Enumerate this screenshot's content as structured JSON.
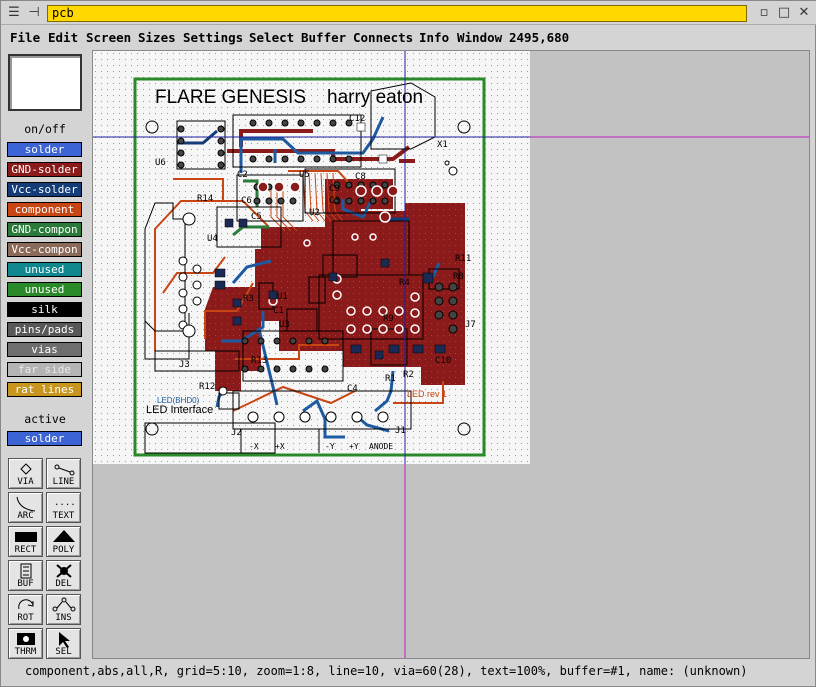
{
  "window": {
    "title": "pcb"
  },
  "menu": {
    "items": [
      "File",
      "Edit",
      "Screen",
      "Sizes",
      "Settings",
      "Select",
      "Buffer",
      "Connects",
      "Info",
      "Window"
    ],
    "cursor_coords": "2495,680"
  },
  "panel": {
    "onoff_label": "on/off",
    "active_label": "active",
    "active_layer": "solder",
    "active_layer_color": "#3c64d4",
    "layers": [
      {
        "label": "solder",
        "bg": "#3c64d4",
        "fg": "#ffffff"
      },
      {
        "label": "GND-solder",
        "bg": "#8b1a1a",
        "fg": "#ffffff"
      },
      {
        "label": "Vcc-solder",
        "bg": "#143c78",
        "fg": "#ffffff"
      },
      {
        "label": "component",
        "bg": "#c84614",
        "fg": "#ffffff"
      },
      {
        "label": "GND-compon",
        "bg": "#2a7a3a",
        "fg": "#ffffff"
      },
      {
        "label": "Vcc-compon",
        "bg": "#8a6a58",
        "fg": "#ffffff"
      },
      {
        "label": "unused",
        "bg": "#10868e",
        "fg": "#ffffff"
      },
      {
        "label": "unused",
        "bg": "#2a8a2a",
        "fg": "#ffffff"
      },
      {
        "label": "silk",
        "bg": "#000000",
        "fg": "#ffffff"
      },
      {
        "label": "pins/pads",
        "bg": "#585858",
        "fg": "#ffffff"
      },
      {
        "label": "vias",
        "bg": "#6e6e6e",
        "fg": "#ffffff"
      },
      {
        "label": "far side",
        "bg": "#b4b4b4",
        "fg": "#e8e8e8"
      },
      {
        "label": "rat lines",
        "bg": "#c8961e",
        "fg": "#ffffff"
      }
    ],
    "tools": [
      {
        "label": "VIA",
        "icon": "via-icon"
      },
      {
        "label": "LINE",
        "icon": "line-icon"
      },
      {
        "label": "ARC",
        "icon": "arc-icon"
      },
      {
        "label": "TEXT",
        "icon": "text-icon"
      },
      {
        "label": "RECT",
        "icon": "rect-icon"
      },
      {
        "label": "POLY",
        "icon": "poly-icon"
      },
      {
        "label": "BUF",
        "icon": "buffer-icon"
      },
      {
        "label": "DEL",
        "icon": "delete-icon"
      },
      {
        "label": "ROT",
        "icon": "rotate-icon"
      },
      {
        "label": "INS",
        "icon": "insert-icon"
      },
      {
        "label": "THRM",
        "icon": "thermal-icon"
      },
      {
        "label": "SEL",
        "icon": "select-icon"
      }
    ]
  },
  "board": {
    "title_text": "FLARE GENESIS",
    "author_text": "harry eaton",
    "subtitle": "LED Interface",
    "led_text": "LED rev 1",
    "small_blue_text": "LED(BHD0)",
    "bottom_labels": [
      "-X",
      "+X",
      "-Y",
      "+Y",
      "ANODE"
    ],
    "refdes": [
      "U6",
      "R14",
      "C12",
      "X1",
      "C2",
      "U5",
      "C8",
      "C6",
      "U2",
      "C5",
      "C3",
      "C9",
      "R12",
      "U4",
      "J3",
      "J1",
      "J2",
      "R13",
      "U3",
      "C1",
      "R3",
      "R4",
      "R9",
      "R1",
      "R11",
      "C10",
      "J7",
      "R2",
      "C4",
      "R8",
      "U1"
    ],
    "colors": {
      "outline": "#2a8a2a",
      "copper_fill": "#8b1a1a",
      "solder": "#1e5aa0",
      "component": "#c84614",
      "crosshair_v": "#c020c0",
      "crosshair_h": "#2020a0"
    }
  },
  "status": {
    "text": "component,abs,all,R, grid=5:10, zoom=1:8, line=10, via=60(28), text=100%, buffer=#1, name: (unknown)"
  }
}
